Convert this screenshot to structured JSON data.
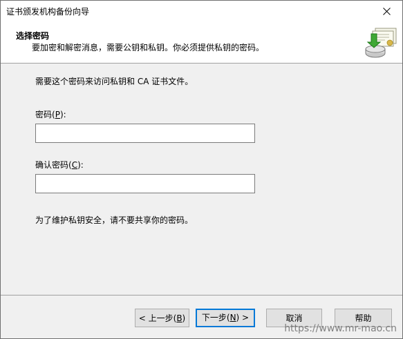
{
  "window": {
    "title": "证书颁发机构备份向导"
  },
  "header": {
    "title": "选择密码",
    "subtitle": "要加密和解密消息，需要公钥和私钥。你必须提供私钥的密码。"
  },
  "body": {
    "intro": "需要这个密码来访问私钥和 CA 证书文件。",
    "password": {
      "label": "密码",
      "accel_open": "(",
      "accel_key": "P",
      "accel_close": "):",
      "value": ""
    },
    "confirm": {
      "label": "确认密码",
      "accel_open": "(",
      "accel_key": "C",
      "accel_close": "):",
      "value": ""
    },
    "warning": "为了维护私钥安全，请不要共享你的密码。"
  },
  "footer": {
    "back": {
      "prefix": "< 上一步(",
      "key": "B",
      "suffix": ")"
    },
    "next": {
      "prefix": "下一步(",
      "key": "N",
      "suffix": ") >"
    },
    "cancel": "取消",
    "help": "帮助"
  },
  "watermark": "https://www.mr-mao.cn",
  "icons": {
    "close": "close-icon",
    "header_graphic": "certificate-backup-icon"
  },
  "colors": {
    "body_bg": "#f0f0f0",
    "header_bg": "#ffffff",
    "default_button_border": "#0078d7",
    "button_bg": "#e1e1e1"
  }
}
